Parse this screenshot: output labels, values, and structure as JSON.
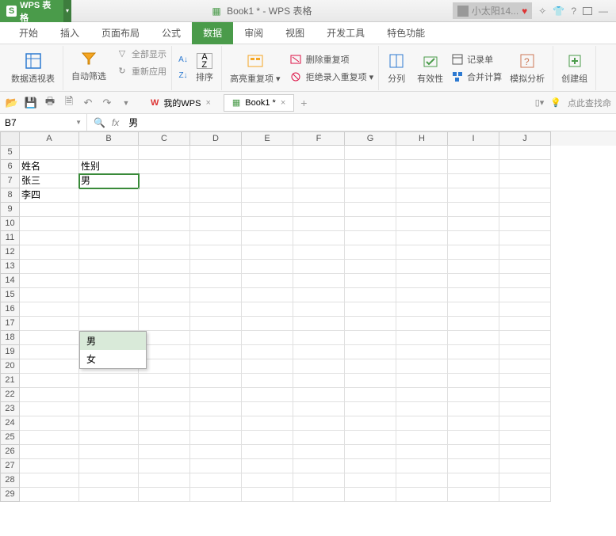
{
  "title_bar": {
    "app_name": "WPS 表格",
    "doc_title": "Book1 * - WPS 表格",
    "user_name": "小太阳14..."
  },
  "menu_tabs": [
    "开始",
    "插入",
    "页面布局",
    "公式",
    "数据",
    "审阅",
    "视图",
    "开发工具",
    "特色功能"
  ],
  "ribbon": {
    "pivot": "数据透视表",
    "autofilter": "自动筛选",
    "show_all": "全部显示",
    "reapply": "重新应用",
    "sort": "排序",
    "highlight_dup": "高亮重复项",
    "remove_dup": "删除重复项",
    "reject_dup": "拒绝录入重复项",
    "text_to_col": "分列",
    "validation": "有效性",
    "record_form": "记录单",
    "consolidate": "合并计算",
    "what_if": "模拟分析",
    "group": "创建组"
  },
  "doc_tabs": {
    "my_wps": "我的WPS",
    "book1": "Book1 *",
    "search_hint": "点此查找命"
  },
  "formula_bar": {
    "name_box": "B7",
    "fx_label": "fx",
    "content": "男"
  },
  "columns": [
    "A",
    "B",
    "C",
    "D",
    "E",
    "F",
    "G",
    "H",
    "I",
    "J"
  ],
  "row_start": 5,
  "row_end": 29,
  "cells": {
    "A6": "姓名",
    "B6": "性别",
    "A7": "张三",
    "B7": "男",
    "A8": "李四"
  },
  "dropdown": {
    "options": [
      "男",
      "女"
    ],
    "hovered": 0
  },
  "chart_data": null
}
